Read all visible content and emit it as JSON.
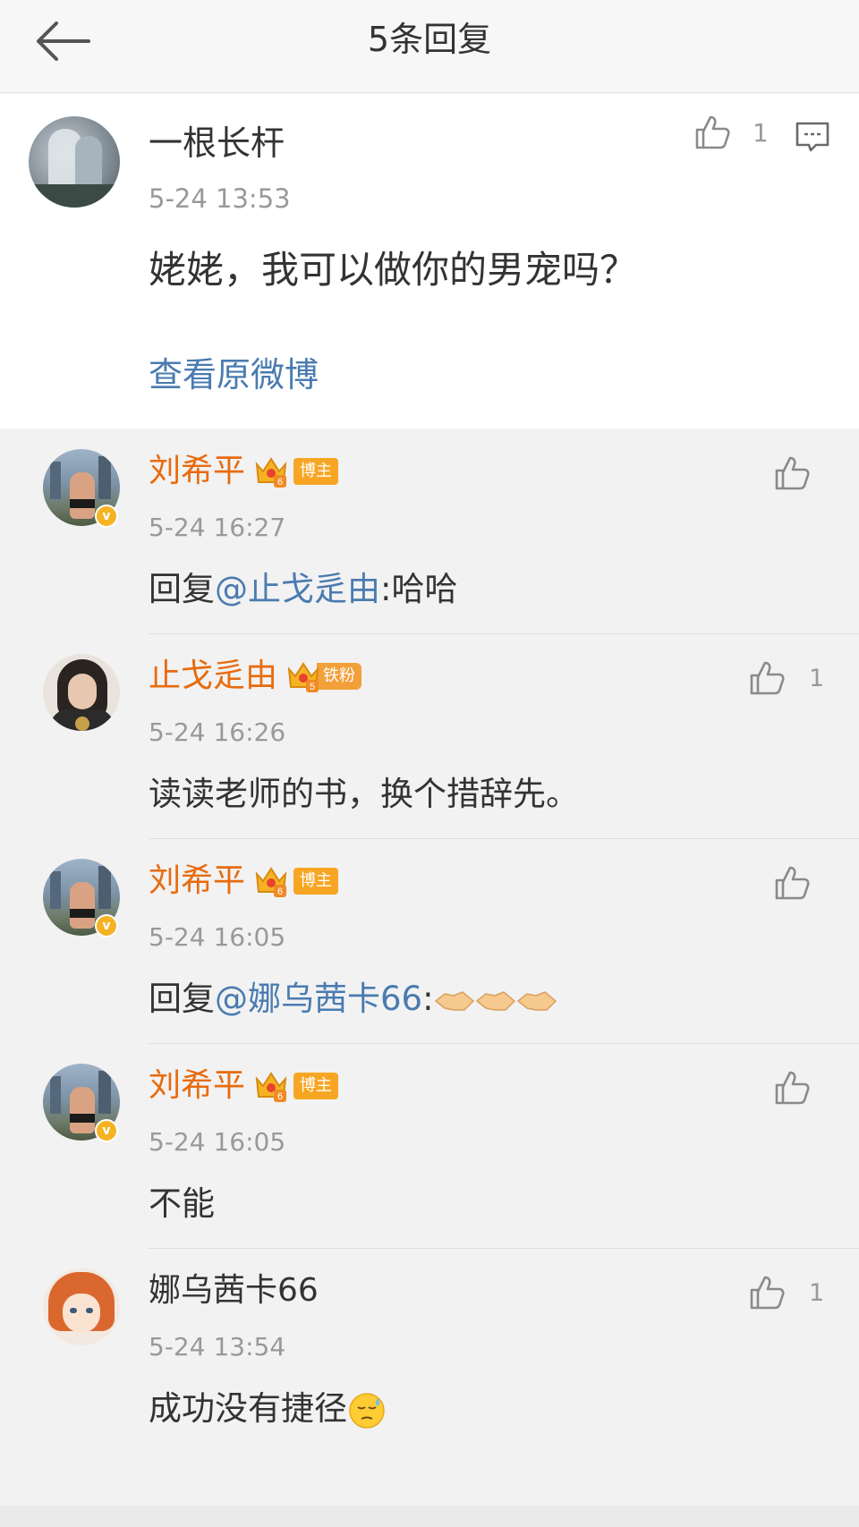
{
  "header": {
    "title": "5条回复",
    "back_icon": "arrow-left-icon"
  },
  "main_comment": {
    "user": "一根长杆",
    "time": "5-24 13:53",
    "text": "姥姥，我可以做你的男宠吗？",
    "like_count": "1",
    "view_original_link": "查看原微博"
  },
  "replies": [
    {
      "user": "刘希平",
      "crown_level": "6",
      "tag": "博主",
      "time": "5-24 16:27",
      "prefix": "回复",
      "mention": "@止戈辵由",
      "suffix": ":哈哈",
      "like_count": ""
    },
    {
      "user": "止戈辵由",
      "crown_level": "5",
      "tag": "铁粉",
      "time": "5-24 16:26",
      "text": "读读老师的书，换个措辞先。",
      "like_count": "1"
    },
    {
      "user": "刘希平",
      "crown_level": "6",
      "tag": "博主",
      "time": "5-24 16:05",
      "prefix": "回复",
      "mention": "@娜乌茜卡66",
      "suffix": ":",
      "emoji": "handshake-emoji x3",
      "like_count": ""
    },
    {
      "user": "刘希平",
      "crown_level": "6",
      "tag": "博主",
      "time": "5-24 16:05",
      "text": "不能",
      "like_count": ""
    },
    {
      "user": "娜乌茜卡66",
      "time": "5-24 13:54",
      "text": "成功没有捷径",
      "emoji": "sweat-emoji",
      "like_count": "1"
    }
  ],
  "colors": {
    "accent_link": "#4a7bb0",
    "vip_name": "#e86b0e",
    "badge": "#f7a623",
    "muted": "#999999"
  }
}
